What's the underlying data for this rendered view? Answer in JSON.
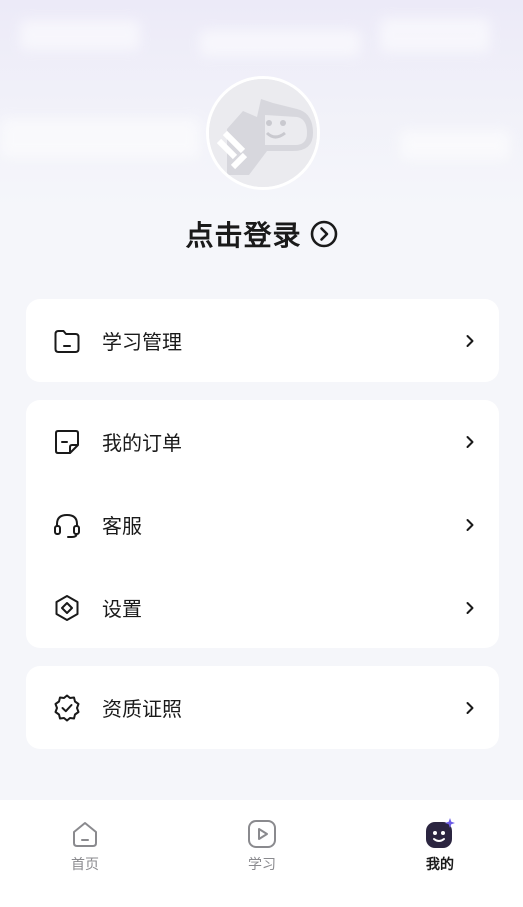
{
  "header": {
    "login_label": "点击登录"
  },
  "menu": {
    "group1": [
      {
        "label": "学习管理",
        "icon": "folder-icon"
      }
    ],
    "group2": [
      {
        "label": "我的订单",
        "icon": "order-doc-icon"
      },
      {
        "label": "客服",
        "icon": "headset-icon"
      },
      {
        "label": "设置",
        "icon": "settings-icon"
      }
    ],
    "group3": [
      {
        "label": "资质证照",
        "icon": "certificate-badge-icon"
      }
    ]
  },
  "tabbar": {
    "tabs": [
      {
        "label": "首页",
        "icon": "home-icon",
        "active": false
      },
      {
        "label": "学习",
        "icon": "play-icon",
        "active": false
      },
      {
        "label": "我的",
        "icon": "profile-face-icon",
        "active": true
      }
    ]
  },
  "colors": {
    "background": "#f5f6fa",
    "card": "#ffffff",
    "text_primary": "#1a1a1a",
    "text_muted": "#8a8a8e",
    "accent_purple": "#6c5ce7"
  }
}
